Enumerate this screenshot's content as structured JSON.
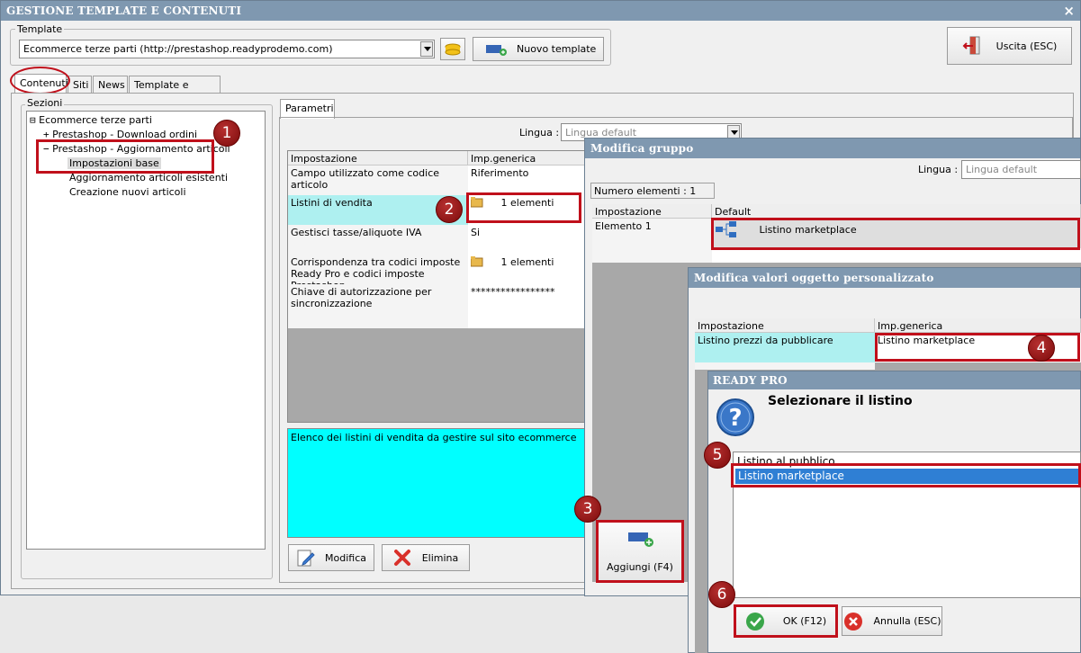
{
  "window": {
    "title": "GESTIONE TEMPLATE E CONTENUTI",
    "close_glyph": "×"
  },
  "template": {
    "group_label": "Template",
    "selected": "Ecommerce terze parti (http://prestashop.readyprodemo.com)",
    "new_button": "Nuovo template"
  },
  "exit_button": "Uscita (ESC)",
  "main_tabs": [
    "Contenuti",
    "Siti",
    "News",
    "Template e plugins"
  ],
  "sections": {
    "label": "Sezioni",
    "root": "Ecommerce terze parti",
    "items": [
      "Prestashop - Download ordini",
      "Prestashop - Aggiornamento articoli",
      "Impostazioni base",
      "Aggiornamento articoli esistenti",
      "Creazione nuovi articoli"
    ]
  },
  "params": {
    "tab": "Parametri",
    "lingua_label": "Lingua :",
    "lingua_value": "Lingua default",
    "col_setting": "Impostazione",
    "col_generic": "Imp.generica",
    "rows": [
      {
        "setting": "Campo utilizzato come codice articolo",
        "value": "Riferimento"
      },
      {
        "setting": "Listini di vendita",
        "value": "1 elementi"
      },
      {
        "setting": "Gestisci tasse/aliquote IVA",
        "value": "Si"
      },
      {
        "setting": "Corrispondenza tra codici imposte Ready Pro e codici imposte Prestashop",
        "value": "1 elementi"
      },
      {
        "setting": "Chiave di autorizzazione per sincronizzazione",
        "value": "*****************"
      }
    ],
    "description": "Elenco dei listini di vendita da gestire sul sito ecommerce",
    "modify_button": "Modifica",
    "delete_button": "Elimina"
  },
  "group_dialog": {
    "title": "Modifica gruppo",
    "lingua_label": "Lingua :",
    "lingua_value": "Lingua default",
    "count": "Numero elementi : 1",
    "col_setting": "Impostazione",
    "col_default": "Default",
    "row_setting": "Elemento 1",
    "row_value": "Listino marketplace",
    "add_button": "Aggiungi (F4)"
  },
  "custom_dialog": {
    "title": "Modifica valori oggetto personalizzato",
    "col_setting": "Impostazione",
    "col_generic": "Imp.generica",
    "row_setting": "Listino prezzi da pubblicare",
    "row_value": "Listino marketplace"
  },
  "ready_dialog": {
    "title": "READY PRO",
    "heading": "Selezionare il listino",
    "options": [
      "Listino al pubblico",
      "Listino marketplace"
    ],
    "selected_index": 1,
    "ok_button": "OK (F12)",
    "cancel_button": "Annulla (ESC)"
  },
  "badges": [
    "1",
    "2",
    "3",
    "4",
    "5",
    "6"
  ],
  "colors": {
    "highlight_red": "#c0101b",
    "selection_blue": "#2f7fd4",
    "cyan": "#00ffff",
    "light_cyan": "#aef0f0"
  }
}
